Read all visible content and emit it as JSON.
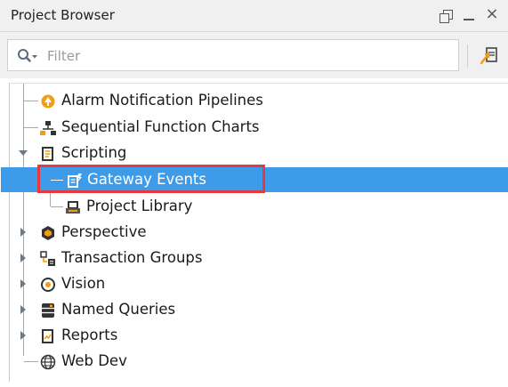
{
  "panel": {
    "title": "Project Browser"
  },
  "filter": {
    "placeholder": "Filter"
  },
  "tree": {
    "items": [
      {
        "label": "Alarm Notification Pipelines",
        "icon": "alarm-pipeline-icon"
      },
      {
        "label": "Sequential Function Charts",
        "icon": "sfc-icon"
      },
      {
        "label": "Scripting",
        "icon": "scripting-icon",
        "expanded": true
      },
      {
        "label": "Gateway Events",
        "icon": "gateway-events-icon",
        "selected": true
      },
      {
        "label": "Project Library",
        "icon": "project-library-icon"
      },
      {
        "label": "Perspective",
        "icon": "perspective-icon"
      },
      {
        "label": "Transaction Groups",
        "icon": "transaction-groups-icon"
      },
      {
        "label": "Vision",
        "icon": "vision-icon"
      },
      {
        "label": "Named Queries",
        "icon": "named-queries-icon"
      },
      {
        "label": "Reports",
        "icon": "reports-icon"
      },
      {
        "label": "Web Dev",
        "icon": "web-dev-icon"
      }
    ]
  },
  "colors": {
    "selection": "#3d9be9",
    "highlight_border": "#e53940",
    "accent_orange": "#f39c12"
  }
}
